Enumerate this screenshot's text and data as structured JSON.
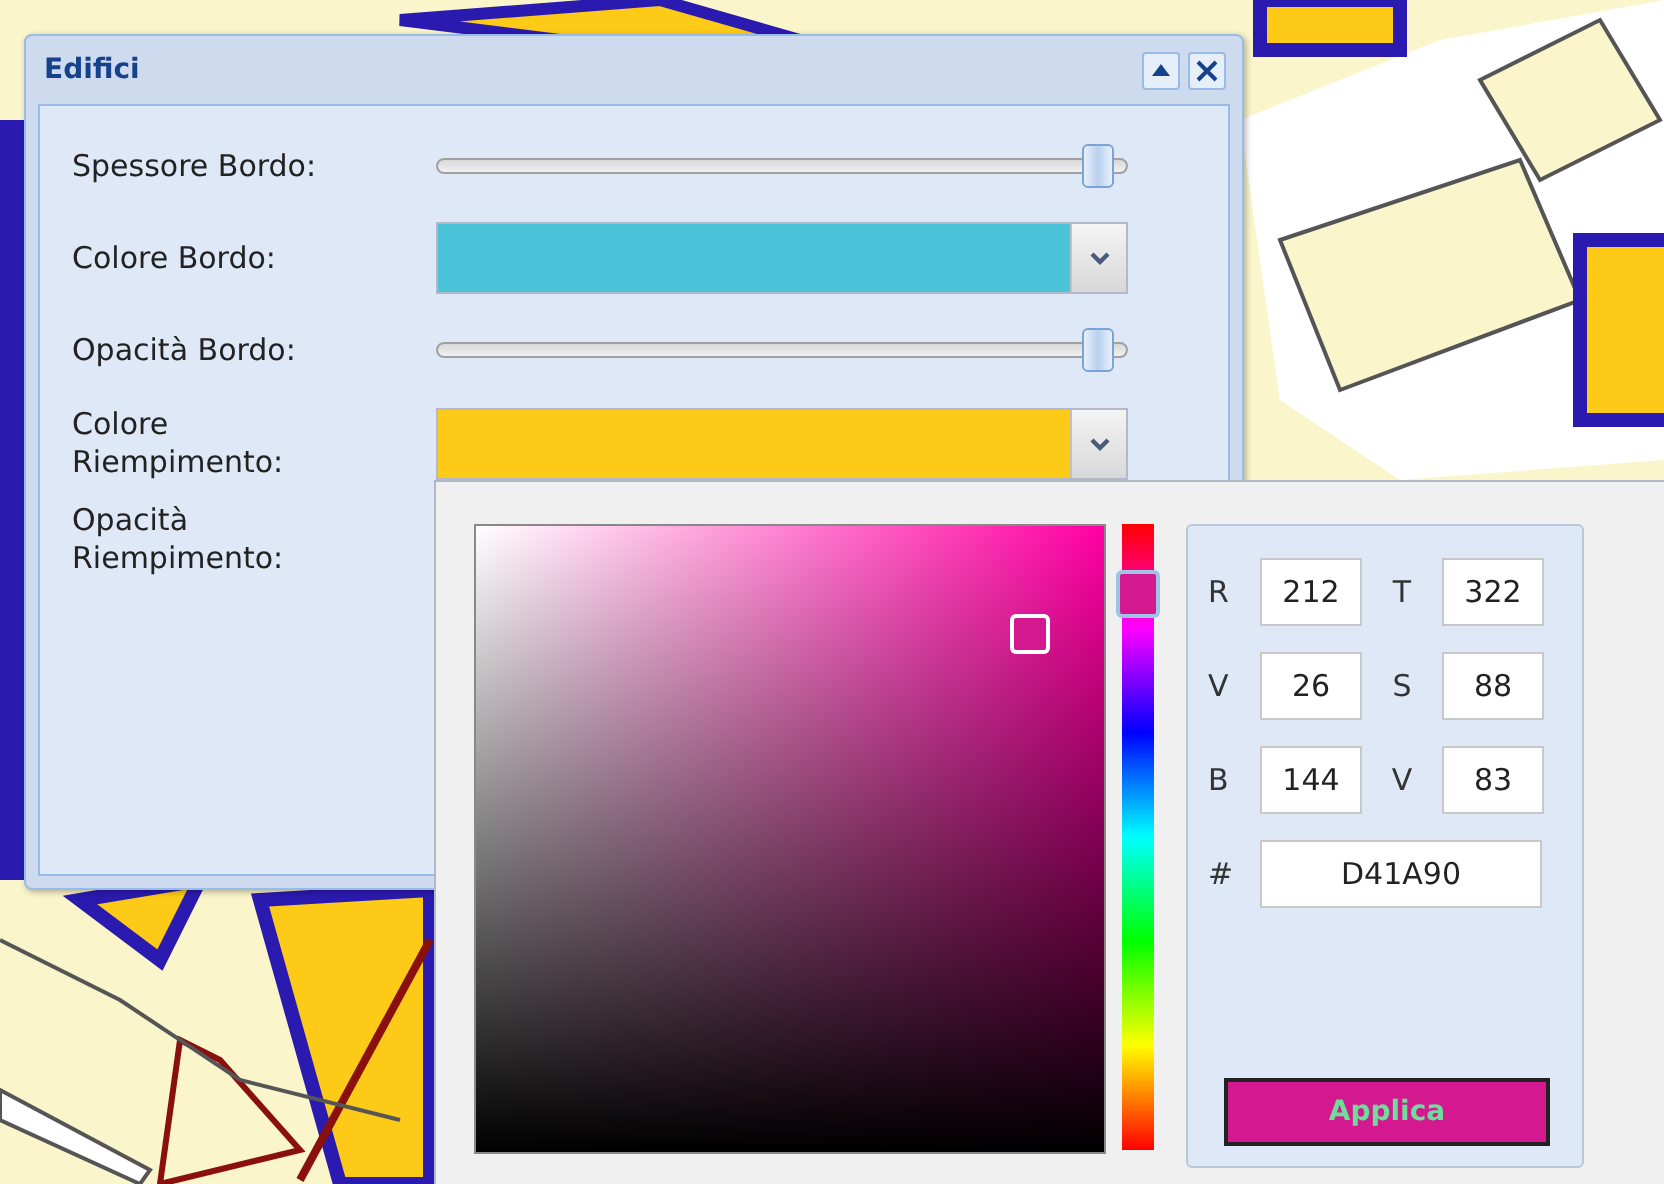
{
  "dialog": {
    "title": "Edifici",
    "fields": [
      {
        "kind": "slider",
        "label": "Spessore Bordo:",
        "level": 0.98
      },
      {
        "kind": "color",
        "label": "Colore Bordo:",
        "color": "#4bc3d9"
      },
      {
        "kind": "slider",
        "label": "Opacità Bordo:",
        "level": 0.98
      },
      {
        "kind": "color",
        "label": "Colore Riempimento:",
        "color": "#fdcb17"
      },
      {
        "kind": "covered",
        "label": "Opacità Riempimento:"
      }
    ]
  },
  "color_picker": {
    "hue": {
      "level": 0.894
    },
    "saturation": {
      "level": 0.88
    },
    "value": {
      "level": 0.83
    },
    "fields": [
      {
        "label": "R",
        "value": "212"
      },
      {
        "label": "T",
        "value": "322"
      },
      {
        "label": "V",
        "value": "26"
      },
      {
        "label": "S",
        "value": "88"
      },
      {
        "label": "B",
        "value": "144"
      },
      {
        "label": "V",
        "value": "83"
      }
    ],
    "hex": {
      "label": "#",
      "value": "D41A90"
    },
    "apply_button": {
      "label": "Applica"
    }
  }
}
